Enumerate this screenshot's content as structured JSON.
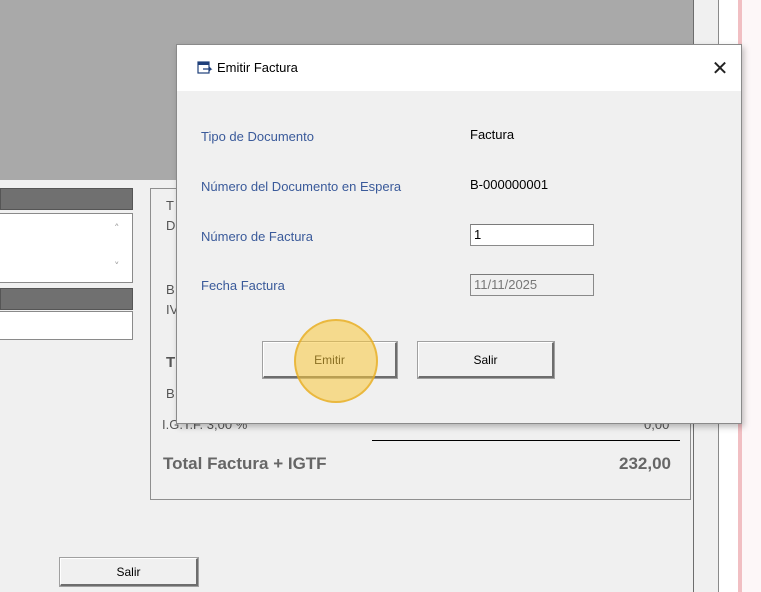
{
  "background": {
    "peek_letters": [
      "T",
      "D",
      "B",
      "IV",
      "T",
      "B"
    ],
    "igtf_label": "I.G.T.F. 3,00 %",
    "igtf_value": "0,00",
    "total_label": "Total Factura + IGTF",
    "total_value": "232,00",
    "salir_label": "Salir",
    "scroll_up": "˄",
    "scroll_down": "˅"
  },
  "dialog": {
    "title": "Emitir Factura",
    "close_glyph": "✕",
    "fields": {
      "tipo_label": "Tipo de Documento",
      "tipo_value": "Factura",
      "numero_espera_label": "Número del Documento en Espera",
      "numero_espera_value": "B-000000001",
      "numero_factura_label": "Número de Factura",
      "numero_factura_value": "1",
      "fecha_label": "Fecha Factura",
      "fecha_value": "11/11/2025"
    },
    "buttons": {
      "emitir_label": "Emitir",
      "salir_label": "Salir"
    }
  },
  "colors": {
    "label_blue": "#3a5a9a",
    "cursor_highlight": "#fac83c"
  },
  "icons": {
    "title_icon": "document-icon",
    "close_icon": "close-icon"
  }
}
